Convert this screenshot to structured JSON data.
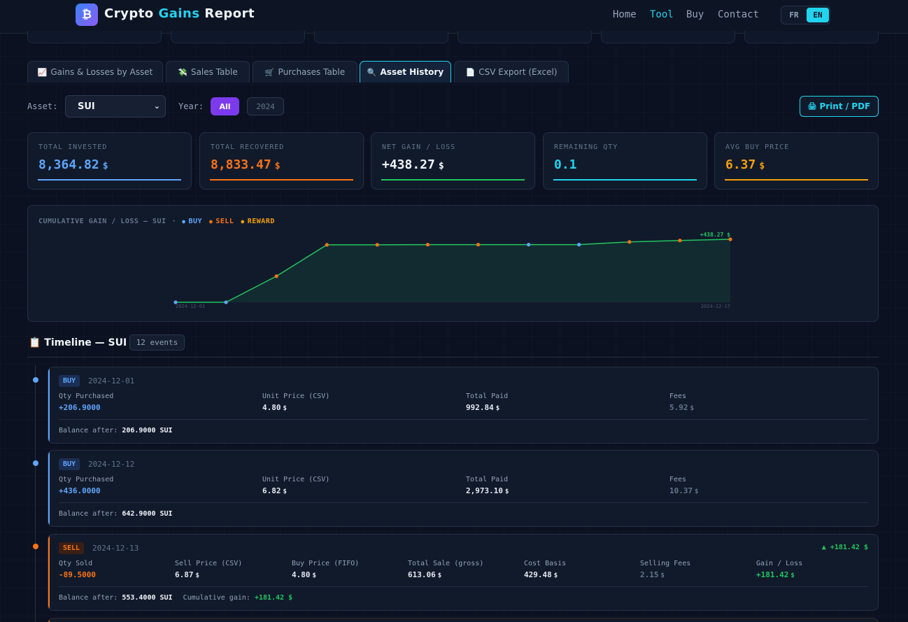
{
  "header": {
    "logo_glyph": "₿",
    "brand_part1": "Crypto ",
    "brand_accent": "Gains",
    "brand_part2": " Report",
    "nav": [
      "Home",
      "Tool",
      "Buy",
      "Contact"
    ],
    "active_nav": "Tool",
    "lang": [
      "FR",
      "EN"
    ],
    "active_lang": "EN"
  },
  "tabs": [
    {
      "icon": "📈",
      "label": "Gains & Losses by Asset"
    },
    {
      "icon": "💸",
      "label": "Sales Table"
    },
    {
      "icon": "🛒",
      "label": "Purchases Table"
    },
    {
      "icon": "🔍",
      "label": "Asset History",
      "active": true
    },
    {
      "icon": "📄",
      "label": "CSV Export (Excel)"
    }
  ],
  "filters": {
    "asset_label": "Asset:",
    "asset_value": "SUI",
    "year_label": "Year:",
    "year_options": [
      "All",
      "2024"
    ],
    "year_selected": "All",
    "print_label": "Print / PDF"
  },
  "stats": [
    {
      "label": "TOTAL INVESTED",
      "value": "8,364.82",
      "unit": "$",
      "color": "#60a5fa"
    },
    {
      "label": "TOTAL RECOVERED",
      "value": "8,833.47",
      "unit": "$",
      "color": "#f97316"
    },
    {
      "label": "NET GAIN / LOSS",
      "value": "+438.27",
      "unit": "$",
      "color": "#22c55e"
    },
    {
      "label": "REMAINING QTY",
      "value": "0.1",
      "unit": "",
      "color": "#22d3ee"
    },
    {
      "label": "AVG BUY PRICE",
      "value": "6.37",
      "unit": "$",
      "color": "#f59e0b"
    }
  ],
  "chart_header": {
    "title": "CUMULATIVE GAIN / LOSS — SUI",
    "separator": "·",
    "legend": [
      {
        "label": "BUY",
        "color": "#60a5fa"
      },
      {
        "label": "SELL",
        "color": "#f97316"
      },
      {
        "label": "REWARD",
        "color": "#f59e0b"
      }
    ]
  },
  "chart_data": {
    "type": "area",
    "title": "CUMULATIVE GAIN / LOSS — SUI",
    "x_start_label": "2024-12-01",
    "x_end_label": "2024-12-17",
    "end_label": "+438.27 $",
    "points": [
      {
        "kind": "buy",
        "y": 0
      },
      {
        "kind": "buy",
        "y": 0
      },
      {
        "kind": "sell",
        "y": 181.42
      },
      {
        "kind": "sell",
        "y": 400
      },
      {
        "kind": "sell",
        "y": 400
      },
      {
        "kind": "sell",
        "y": 401
      },
      {
        "kind": "sell",
        "y": 401
      },
      {
        "kind": "buy",
        "y": 401
      },
      {
        "kind": "buy",
        "y": 401
      },
      {
        "kind": "sell",
        "y": 420
      },
      {
        "kind": "sell",
        "y": 430
      },
      {
        "kind": "sell",
        "y": 438.27
      }
    ],
    "ylim": [
      0,
      438.27
    ],
    "colors": {
      "line": "#22c55e",
      "buy": "#60a5fa",
      "sell": "#f97316",
      "fill": "#22c55e"
    }
  },
  "timeline": {
    "title": "📋 Timeline — SUI",
    "count": "12 events",
    "events": [
      {
        "type": "BUY",
        "date": "2024-12-01",
        "fields": [
          {
            "label": "Qty Purchased",
            "value": "+206.9000",
            "unit": ""
          },
          {
            "label": "Unit Price (CSV)",
            "value": "4.80",
            "unit": "$"
          },
          {
            "label": "Total Paid",
            "value": "992.84",
            "unit": "$"
          },
          {
            "label": "Fees",
            "value": "5.92",
            "unit": "$"
          }
        ],
        "balance_label": "Balance after:",
        "balance": "206.9000 SUI"
      },
      {
        "type": "BUY",
        "date": "2024-12-12",
        "fields": [
          {
            "label": "Qty Purchased",
            "value": "+436.0000",
            "unit": ""
          },
          {
            "label": "Unit Price (CSV)",
            "value": "6.82",
            "unit": "$"
          },
          {
            "label": "Total Paid",
            "value": "2,973.10",
            "unit": "$"
          },
          {
            "label": "Fees",
            "value": "10.37",
            "unit": "$"
          }
        ],
        "balance_label": "Balance after:",
        "balance": "642.9000 SUI"
      },
      {
        "type": "SELL",
        "date": "2024-12-13",
        "gain_top": "▲ +181.42 $",
        "fields": [
          {
            "label": "Qty Sold",
            "value": "-89.5000",
            "unit": ""
          },
          {
            "label": "Sell Price (CSV)",
            "value": "6.87",
            "unit": "$"
          },
          {
            "label": "Buy Price (FIFO)",
            "value": "4.80",
            "unit": "$"
          },
          {
            "label": "Total Sale (gross)",
            "value": "613.06",
            "unit": "$"
          },
          {
            "label": "Cost Basis",
            "value": "429.48",
            "unit": "$"
          },
          {
            "label": "Selling Fees",
            "value": "2.15",
            "unit": "$"
          },
          {
            "label": "Gain / Loss",
            "value": "+181.42",
            "unit": "$"
          }
        ],
        "balance_label": "Balance after:",
        "balance": "553.4000 SUI",
        "cum_label": "Cumulative gain:",
        "cum_value": "+181.42 $"
      }
    ]
  }
}
